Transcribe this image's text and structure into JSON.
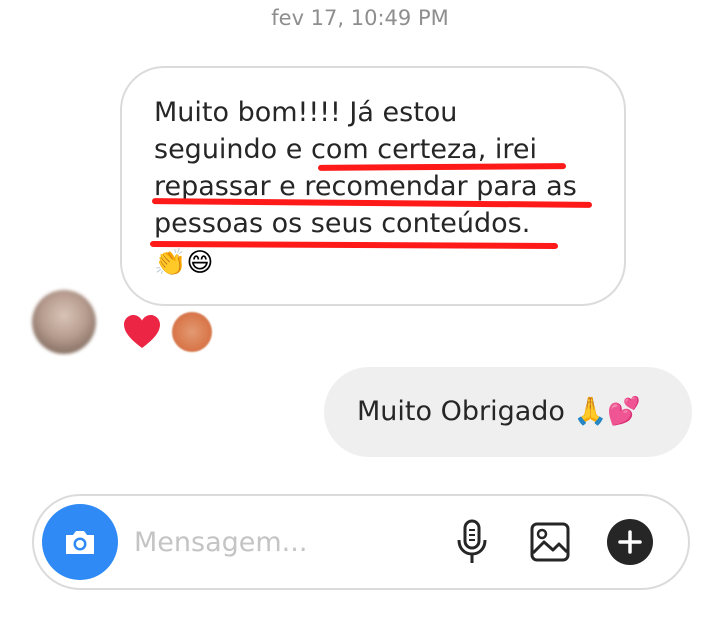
{
  "timestamp": "fev 17, 10:49 PM",
  "incoming_message": {
    "text": "Muito bom!!!! Já estou\nseguindo e com certeza, irei\nrepassar e recomendar para as\npessoas os seus conteúdos.",
    "emojis": "👏😄",
    "highlight_color": "#ff1a1a",
    "reactions": [
      "heart-icon",
      "reactor-avatar"
    ],
    "reaction_heart_color": "#ed2545"
  },
  "outgoing_message": {
    "text": "Muito Obrigado 🙏💕"
  },
  "composer": {
    "placeholder": "Mensagem...",
    "accent_color": "#2f8af5"
  },
  "icons": [
    "camera-icon",
    "microphone-icon",
    "gallery-icon",
    "plus-icon"
  ]
}
